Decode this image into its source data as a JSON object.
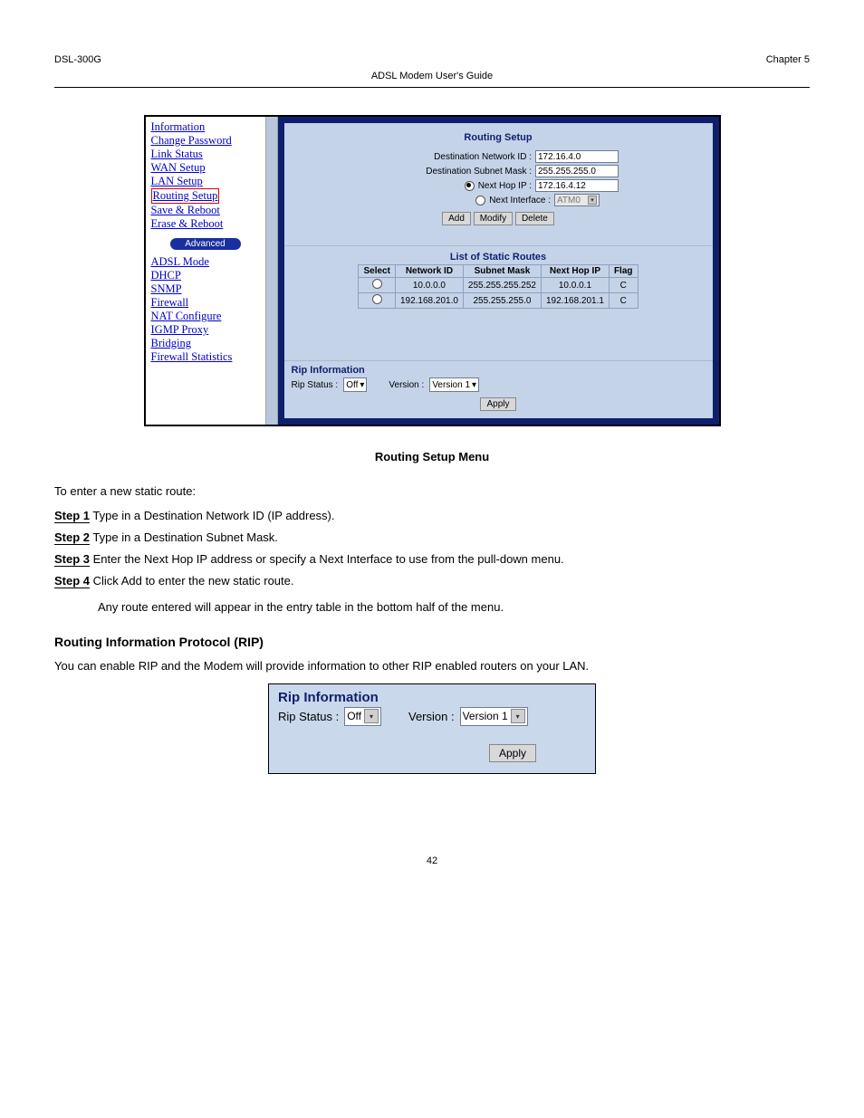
{
  "doc_header": {
    "model": "DSL-300G",
    "title_line": "ADSL Modem User's Guide",
    "chapter": "Chapter 5"
  },
  "sidebar": {
    "items": [
      "Information",
      "Change Password",
      "Link Status",
      "WAN Setup",
      "LAN Setup",
      "Routing Setup",
      "Save & Reboot",
      "Erase & Reboot"
    ],
    "advanced_label": "Advanced",
    "adv_items": [
      "ADSL Mode",
      "DHCP",
      "SNMP",
      "Firewall",
      "NAT Configure",
      "IGMP Proxy",
      "Bridging",
      "Firewall Statistics"
    ]
  },
  "panel": {
    "title": "Routing Setup",
    "dest_net_label": "Destination Network ID :",
    "dest_net_value": "172.16.4.0",
    "dest_mask_label": "Destination Subnet Mask :",
    "dest_mask_value": "255.255.255.0",
    "nexthop_label": "Next Hop IP :",
    "nexthop_value": "172.16.4.12",
    "nextif_label": "Next Interface :",
    "nextif_value": "ATM0",
    "btn_add": "Add",
    "btn_modify": "Modify",
    "btn_delete": "Delete",
    "list_title": "List of Static Routes",
    "table": {
      "headers": [
        "Select",
        "Network ID",
        "Subnet Mask",
        "Next Hop IP",
        "Flag"
      ],
      "rows": [
        [
          "",
          "10.0.0.0",
          "255.255.255.252",
          "10.0.0.1",
          "C"
        ],
        [
          "",
          "192.168.201.0",
          "255.255.255.0",
          "192.168.201.1",
          "C"
        ]
      ]
    },
    "rip_title": "Rip Information",
    "rip_status_label": "Rip Status :",
    "rip_status_value": "Off",
    "rip_version_label": "Version :",
    "rip_version_value": "Version 1",
    "apply": "Apply"
  },
  "caption": "Routing Setup Menu",
  "steps_intro": "To enter a new static route:",
  "steps": [
    {
      "label": "Step 1",
      "text": "Type in a Destination Network ID (IP address)."
    },
    {
      "label": "Step 2",
      "text": "Type in a Destination Subnet Mask."
    },
    {
      "label": "Step 3",
      "text": "Enter the Next Hop IP address or specify a Next Interface to use from the pull-down menu."
    },
    {
      "label": "Step 4",
      "text": "Click Add to enter the new static route."
    }
  ],
  "steps_note": "Any route entered will appear in the entry table in the bottom half of the menu.",
  "rip_section_title": "Routing Information Protocol (RIP)",
  "rip_section_text": "You can enable RIP and the Modem will provide information to other RIP enabled routers on your LAN.",
  "rip_large": {
    "title": "Rip Information",
    "status_label": "Rip Status :",
    "status_value": "Off",
    "version_label": "Version :",
    "version_value": "Version 1",
    "apply": "Apply"
  },
  "footer_page": "42"
}
